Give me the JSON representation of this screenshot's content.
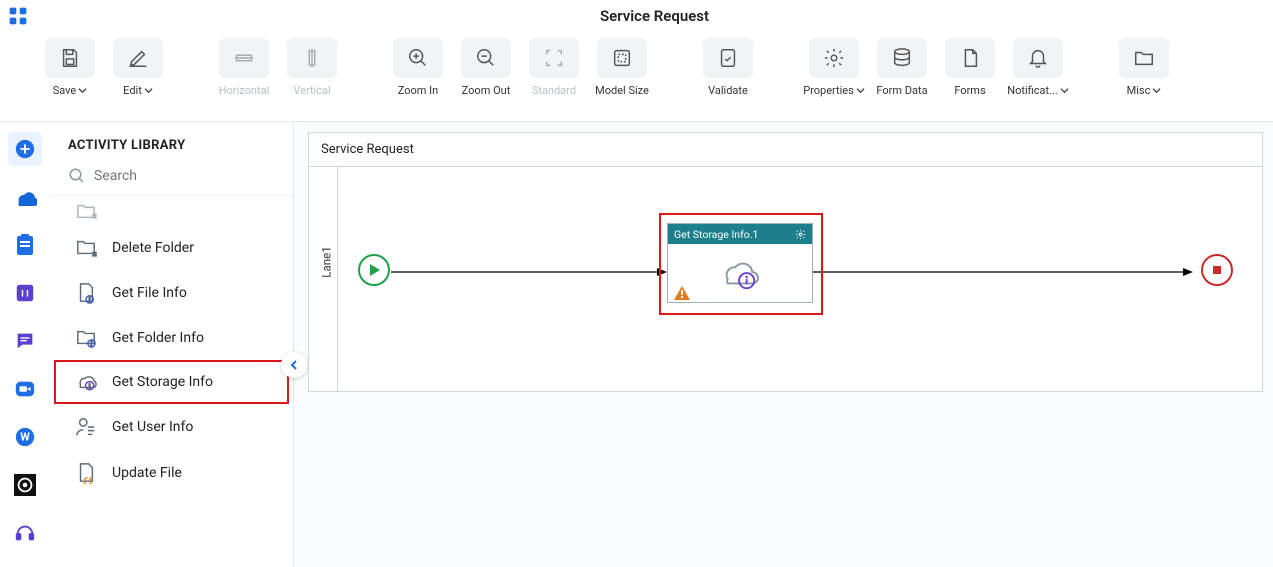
{
  "header": {
    "title": "Service Request"
  },
  "toolbar": {
    "save": "Save",
    "edit": "Edit",
    "horizontal": "Horizontal",
    "vertical": "Vertical",
    "zoom_in": "Zoom In",
    "zoom_out": "Zoom Out",
    "standard": "Standard",
    "model_size": "Model Size",
    "validate": "Validate",
    "properties": "Properties",
    "form_data": "Form Data",
    "forms": "Forms",
    "notifications": "Notificat...",
    "misc": "Misc"
  },
  "sidebar": {
    "title": "ACTIVITY LIBRARY",
    "search_placeholder": "Search",
    "items": {
      "delete_folder": "Delete Folder",
      "get_file_info": "Get File Info",
      "get_folder_info": "Get Folder Info",
      "get_storage_info": "Get Storage Info",
      "get_user_info": "Get User Info",
      "update_file": "Update File"
    }
  },
  "canvas": {
    "title": "Service Request",
    "lane": "Lane1",
    "activity_node": {
      "title": "Get Storage Info.1"
    }
  }
}
